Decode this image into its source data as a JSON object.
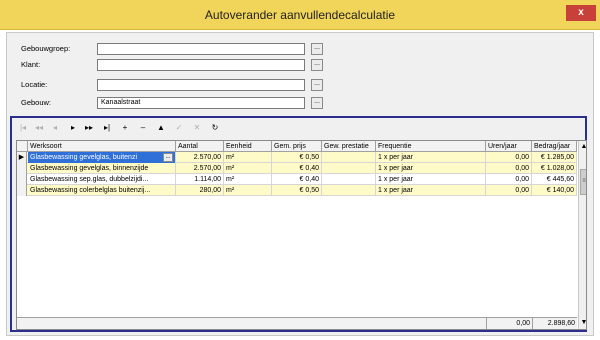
{
  "window": {
    "title": "Autoverander aanvullendecalculatie",
    "close_label": "x",
    "titlebar_color": "#f1d55b",
    "close_color": "#c7403a"
  },
  "form": {
    "fields": [
      {
        "label": "Gebouwgroep:",
        "value": "",
        "button": "..."
      },
      {
        "label": "Klant:",
        "value": "",
        "button": "..."
      },
      {
        "label": "Locatie:",
        "value": "",
        "button": "..."
      },
      {
        "label": "Gebouw:",
        "value": "Kanaalstraat",
        "button": "..."
      }
    ]
  },
  "toolbar": {
    "buttons": [
      {
        "icon": "first-record-icon",
        "glyph": "|◂",
        "enabled": false
      },
      {
        "icon": "prev-page-icon",
        "glyph": "◂◂",
        "enabled": false
      },
      {
        "icon": "prev-record-icon",
        "glyph": "◂",
        "enabled": false
      },
      {
        "icon": "next-record-icon",
        "glyph": "▸",
        "enabled": true
      },
      {
        "icon": "next-page-icon",
        "glyph": "▸▸",
        "enabled": true
      },
      {
        "icon": "last-record-icon",
        "glyph": "▸|",
        "enabled": true
      },
      {
        "icon": "insert-icon",
        "glyph": "+",
        "enabled": true
      },
      {
        "icon": "delete-icon",
        "glyph": "–",
        "enabled": true
      },
      {
        "icon": "edit-icon",
        "glyph": "▲",
        "enabled": true
      },
      {
        "icon": "post-icon",
        "glyph": "✓",
        "enabled": false
      },
      {
        "icon": "cancel-icon",
        "glyph": "✕",
        "enabled": false
      },
      {
        "icon": "refresh-icon",
        "glyph": "↻",
        "enabled": true
      }
    ]
  },
  "grid": {
    "columns": [
      "Werksoort",
      "Aantal",
      "Eenheid",
      "Gem. prijs",
      "Gew. prestatie",
      "Frequentie",
      "Uren/jaar",
      "Bedrag/jaar"
    ],
    "rows": [
      {
        "werksoort": "Glasbewassing gevelglas, buitenzi",
        "aantal": "2.570,00",
        "eenheid": "m²",
        "prijs": "€ 0,50",
        "prestatie": "",
        "frequentie": "1 x per jaar",
        "uren": "0,00",
        "bedrag": "€ 1.285,00",
        "style": "yellow",
        "selected": true
      },
      {
        "werksoort": "Glasbewassing gevelglas, binnenzijde",
        "aantal": "2.570,00",
        "eenheid": "m²",
        "prijs": "€ 0,40",
        "prestatie": "",
        "frequentie": "1 x per jaar",
        "uren": "0,00",
        "bedrag": "€ 1.028,00",
        "style": "yellow",
        "selected": false
      },
      {
        "werksoort": "Glasbewassing sep.glas, dubbelzijdi...",
        "aantal": "1.114,00",
        "eenheid": "m²",
        "prijs": "€ 0,40",
        "prestatie": "",
        "frequentie": "1 x per jaar",
        "uren": "0,00",
        "bedrag": "€ 445,60",
        "style": "white",
        "selected": false
      },
      {
        "werksoort": "Glasbewassing colerbelglas buitenzij...",
        "aantal": "280,00",
        "eenheid": "m²",
        "prijs": "€ 0,50",
        "prestatie": "",
        "frequentie": "1 x per jaar",
        "uren": "0,00",
        "bedrag": "€ 140,00",
        "style": "yellow",
        "selected": false
      }
    ],
    "cell_button": "...",
    "current_row_marker": "▶",
    "totals": {
      "uren": "0,00",
      "bedrag": "2.898,60"
    }
  },
  "scrollbar": {
    "up": "▲",
    "down": "▼",
    "thumb": "≡"
  }
}
